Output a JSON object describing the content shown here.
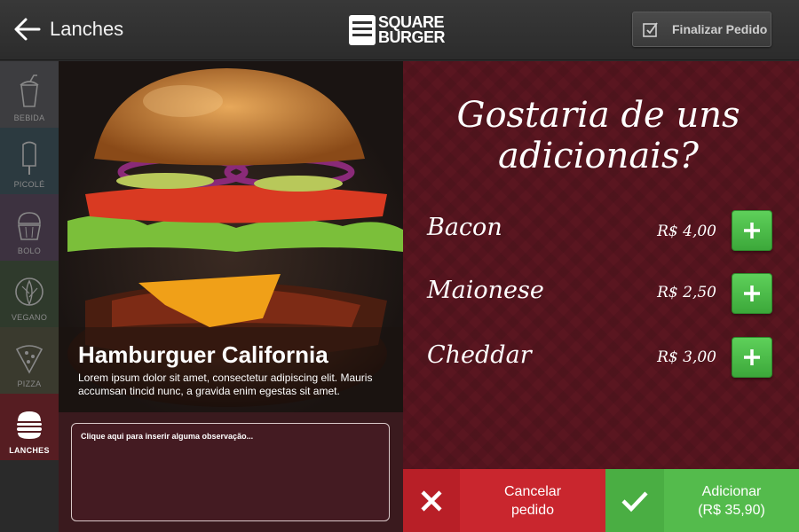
{
  "header": {
    "back_icon": "arrow-left-icon",
    "title": "Lanches",
    "logo": "SQUARE BURGER",
    "finish_label": "Finalizar Pedido",
    "finish_icon": "checkbox-icon"
  },
  "sidebar": {
    "items": [
      {
        "label": "BEBIDA",
        "icon": "cup-icon",
        "color": "#3d3d40"
      },
      {
        "label": "PICOLÉ",
        "icon": "popsicle-icon",
        "color": "#2c3a40"
      },
      {
        "label": "BOLO",
        "icon": "cupcake-icon",
        "color": "#3d3240"
      },
      {
        "label": "VEGANO",
        "icon": "lettuce-icon",
        "color": "#2f3a2c"
      },
      {
        "label": "PIZZA",
        "icon": "pizza-icon",
        "color": "#3a3a2e"
      },
      {
        "label": "LANCHES",
        "icon": "burger-icon",
        "color": "#561d22",
        "active": true
      }
    ]
  },
  "product": {
    "name": "Hamburguer California",
    "description": "Lorem ipsum dolor sit amet, consectetur adipiscing elit. Mauris accumsan tincid nunc, a gravida enim egestas sit amet.",
    "notes_placeholder": "Clique aqui para inserir alguma observação..."
  },
  "addons": {
    "title": "Gostaria de uns adicionais?",
    "items": [
      {
        "name": "Bacon",
        "price": "R$ 4,00"
      },
      {
        "name": "Maionese",
        "price": "R$ 2,50"
      },
      {
        "name": "Cheddar",
        "price": "R$ 3,00"
      }
    ]
  },
  "actions": {
    "cancel_line1": "Cancelar",
    "cancel_line2": "pedido",
    "confirm_line1": "Adicionar",
    "confirm_line2": "(R$ 35,90)"
  },
  "colors": {
    "accent_green": "#54bb4c",
    "accent_red": "#c9262e",
    "panel_maroon": "#5a1620"
  }
}
